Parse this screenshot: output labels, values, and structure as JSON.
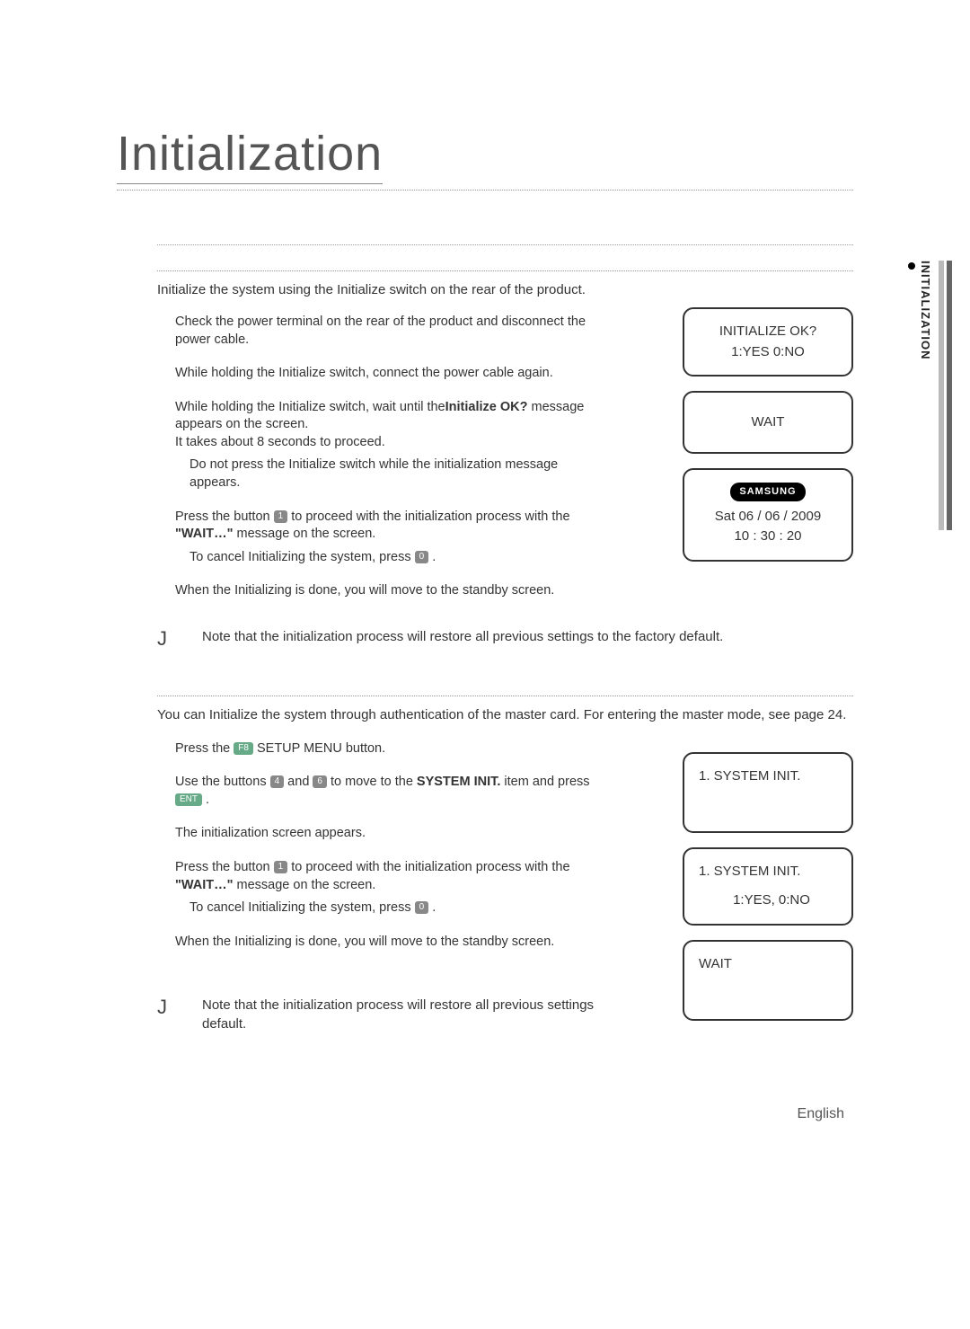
{
  "page_title": "Initialization",
  "side_tab": "INITIALIZATION",
  "section1": {
    "intro": "Initialize the system using the Initialize switch on the rear of the product.",
    "step1": "Check the power terminal on the rear of the product and disconnect the power cable.",
    "step2": "While holding the Initialize switch, connect the power cable again.",
    "step3a": "While holding the Initialize switch, wait until the",
    "step3b": "Initialize OK?",
    "step3c": " message appears on the screen.",
    "step3d": "It takes about 8 seconds to proceed.",
    "step3_sub": "Do not press the Initialize switch while the initialization message appears.",
    "step4a": "Press the button ",
    "step4_key": "1",
    "step4b": " to proceed with the initialization process with the ",
    "step4c": "\"WAIT…\"",
    "step4d": " message on the screen.",
    "step4_sub_a": "To cancel Initializing the system, press",
    "step4_sub_key": "0",
    "step4_sub_b": " .",
    "step5": "When the Initializing is done, you will move to the standby screen.",
    "note": "Note that the initialization process will restore all previous settings to the factory default.",
    "screen1_line1": "INITIALIZE OK?",
    "screen1_line2": "1:YES  0:NO",
    "screen2": "WAIT",
    "screen3_logo": "SAMSUNG",
    "screen3_date": "Sat 06 / 06 / 2009",
    "screen3_time": "10 : 30 : 20"
  },
  "section2": {
    "intro": "You can Initialize the system through authentication of the master card. For entering the master mode, see page 24.",
    "step1a": "Press the ",
    "step1_key": "F8",
    "step1b": " SETUP MENU button.",
    "step2a": "Use the buttons ",
    "step2_key1": "4",
    "step2b": " and ",
    "step2_key2": "6",
    "step2c": " to move to the ",
    "step2_bold": "SYSTEM INIT.",
    "step2d": " item and press ",
    "step2_key3": "ENT",
    "step2e": " .",
    "step3": "The initialization screen appears.",
    "step4a": "Press the button ",
    "step4_key": "1",
    "step4b": " to proceed with the initialization process with the ",
    "step4c": "\"WAIT…\"",
    "step4d": " message on the screen.",
    "step4_sub_a": "To cancel Initializing the system, press",
    "step4_sub_key": "0",
    "step4_sub_b": " .",
    "step5": "When the Initializing is done, you will move to the standby screen.",
    "note": "Note that the initialization process will restore all previous settings default.",
    "screen1": "1. SYSTEM INIT.",
    "screen2_line1": "1. SYSTEM INIT.",
    "screen2_line2": "1:YES,   0:NO",
    "screen3": "WAIT"
  },
  "footer": "English",
  "note_mark": "J"
}
